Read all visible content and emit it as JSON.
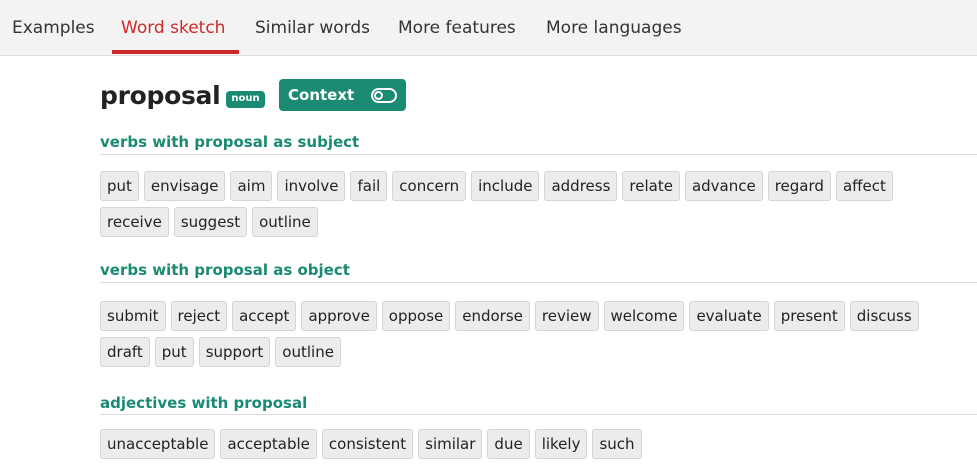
{
  "nav": {
    "tabs": [
      {
        "label": "Examples",
        "active": false
      },
      {
        "label": "Word sketch",
        "active": true
      },
      {
        "label": "Similar words",
        "active": false
      },
      {
        "label": "More features",
        "active": false
      },
      {
        "label": "More languages",
        "active": false
      }
    ]
  },
  "headword": {
    "word": "proposal",
    "pos": "noun"
  },
  "context_toggle": {
    "label": "Context",
    "icon": "toggle-icon"
  },
  "relations": [
    {
      "title": "verbs with proposal as subject",
      "rows": [
        [
          "put",
          "envisage",
          "aim",
          "involve",
          "fail",
          "concern",
          "include",
          "address",
          "relate",
          "advance",
          "regard",
          "affect"
        ],
        [
          "receive",
          "suggest",
          "outline"
        ]
      ]
    },
    {
      "title": "verbs with proposal as object",
      "rows": [
        [
          "submit",
          "reject",
          "accept",
          "approve",
          "oppose",
          "endorse",
          "review",
          "welcome",
          "evaluate",
          "present",
          "discuss"
        ],
        [
          "draft",
          "put",
          "support",
          "outline"
        ]
      ]
    },
    {
      "title": "adjectives with proposal",
      "rows": [
        [
          "unacceptable",
          "acceptable",
          "consistent",
          "similar",
          "due",
          "likely",
          "such"
        ]
      ]
    }
  ],
  "colors": {
    "accent_green": "#1a8a72",
    "active_tab_red": "#cc2a2a",
    "chip_bg": "#ececec",
    "nav_bg": "#f3f3f3"
  }
}
